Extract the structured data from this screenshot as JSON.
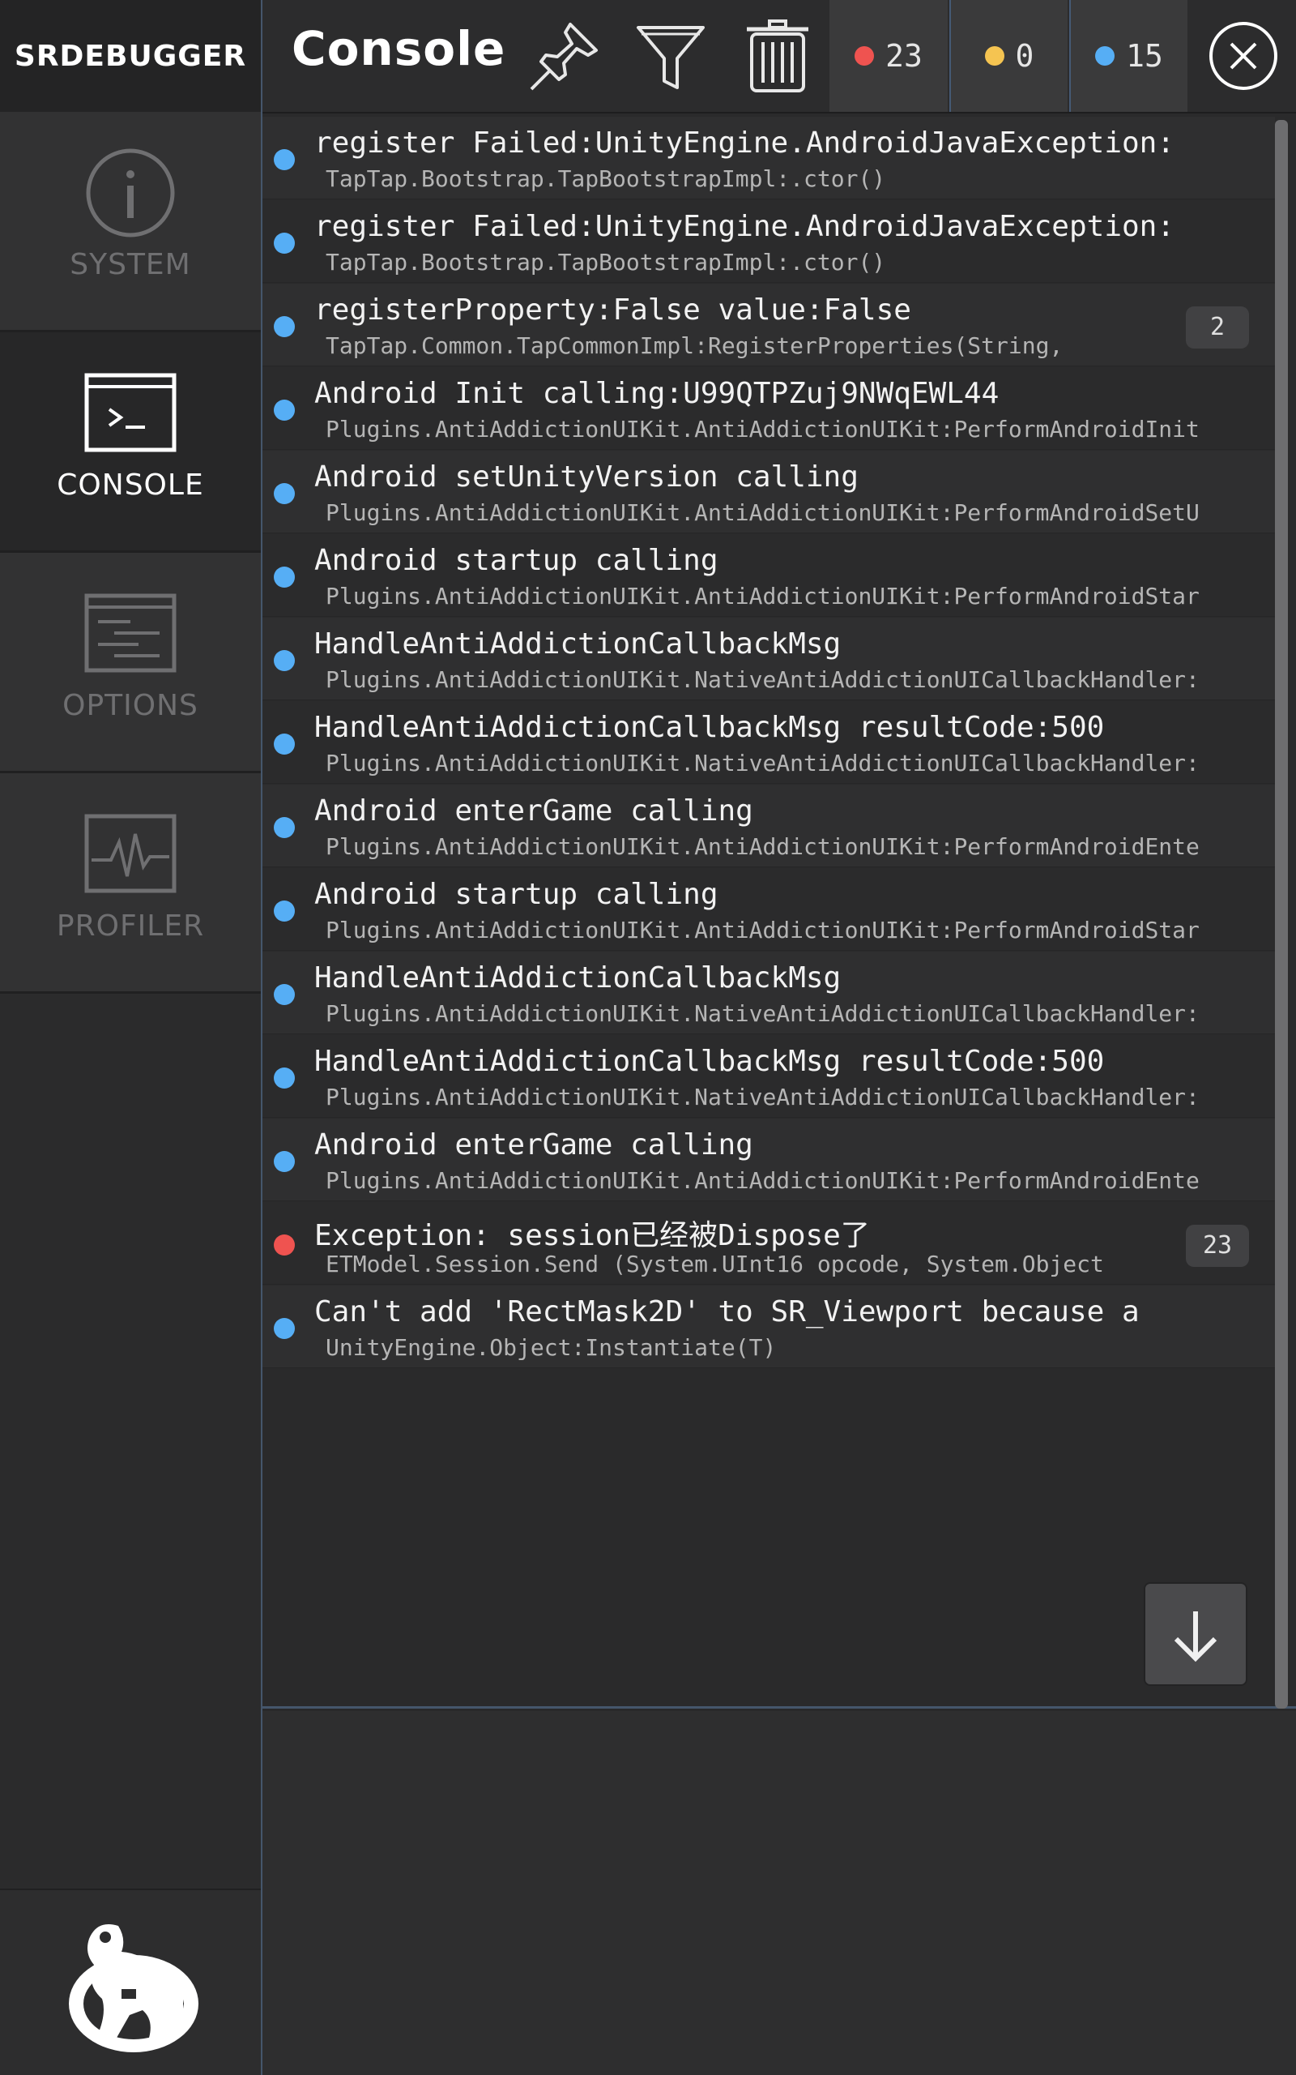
{
  "brand": {
    "prefix": "SR",
    "suffix": "DEBUGGER"
  },
  "sidebar": {
    "items": [
      {
        "label": "SYSTEM",
        "icon": "info-icon",
        "active": false
      },
      {
        "label": "CONSOLE",
        "icon": "terminal-icon",
        "active": true
      },
      {
        "label": "OPTIONS",
        "icon": "options-icon",
        "active": false
      },
      {
        "label": "PROFILER",
        "icon": "pulse-icon",
        "active": false
      }
    ],
    "footer_icon": "robot-logo-icon"
  },
  "header": {
    "title": "Console",
    "pin_icon": "pin-icon",
    "filter_icon": "filter-icon",
    "clear_icon": "trash-icon",
    "close_icon": "close-icon",
    "counters": {
      "error": {
        "count": "23",
        "color": "#ef5350"
      },
      "warning": {
        "count": "0",
        "color": "#f5c451"
      },
      "info": {
        "count": "15",
        "color": "#56aef5"
      }
    }
  },
  "colors": {
    "info": "#56aef5",
    "error": "#ef5350",
    "accent_border": "#45566b"
  },
  "logs": [
    {
      "level": "info",
      "message": "register Failed:UnityEngine.AndroidJavaException:",
      "trace": "TapTap.Bootstrap.TapBootstrapImpl:.ctor()",
      "count": ""
    },
    {
      "level": "info",
      "message": "register Failed:UnityEngine.AndroidJavaException:",
      "trace": "TapTap.Bootstrap.TapBootstrapImpl:.ctor()",
      "count": ""
    },
    {
      "level": "info",
      "message": "registerProperty:False value:False",
      "trace": "TapTap.Common.TapCommonImpl:RegisterProperties(String,",
      "count": "2"
    },
    {
      "level": "info",
      "message": "Android Init calling:U99QTPZuj9NWqEWL44",
      "trace": "Plugins.AntiAddictionUIKit.AntiAddictionUIKit:PerformAndroidInit",
      "count": ""
    },
    {
      "level": "info",
      "message": "Android setUnityVersion calling",
      "trace": "Plugins.AntiAddictionUIKit.AntiAddictionUIKit:PerformAndroidSetU",
      "count": ""
    },
    {
      "level": "info",
      "message": "Android startup calling",
      "trace": "Plugins.AntiAddictionUIKit.AntiAddictionUIKit:PerformAndroidStar",
      "count": ""
    },
    {
      "level": "info",
      "message": "HandleAntiAddictionCallbackMsg",
      "trace": "Plugins.AntiAddictionUIKit.NativeAntiAddictionUICallbackHandler:",
      "count": ""
    },
    {
      "level": "info",
      "message": "HandleAntiAddictionCallbackMsg resultCode:500",
      "trace": "Plugins.AntiAddictionUIKit.NativeAntiAddictionUICallbackHandler:",
      "count": ""
    },
    {
      "level": "info",
      "message": "Android enterGame calling",
      "trace": "Plugins.AntiAddictionUIKit.AntiAddictionUIKit:PerformAndroidEnte",
      "count": ""
    },
    {
      "level": "info",
      "message": "Android startup calling",
      "trace": "Plugins.AntiAddictionUIKit.AntiAddictionUIKit:PerformAndroidStar",
      "count": ""
    },
    {
      "level": "info",
      "message": "HandleAntiAddictionCallbackMsg",
      "trace": "Plugins.AntiAddictionUIKit.NativeAntiAddictionUICallbackHandler:",
      "count": ""
    },
    {
      "level": "info",
      "message": "HandleAntiAddictionCallbackMsg resultCode:500",
      "trace": "Plugins.AntiAddictionUIKit.NativeAntiAddictionUICallbackHandler:",
      "count": ""
    },
    {
      "level": "info",
      "message": "Android enterGame calling",
      "trace": "Plugins.AntiAddictionUIKit.AntiAddictionUIKit:PerformAndroidEnte",
      "count": ""
    },
    {
      "level": "error",
      "message": "Exception: session已经被Dispose了",
      "trace": "ETModel.Session.Send (System.UInt16 opcode, System.Object",
      "count": "23"
    },
    {
      "level": "info",
      "message": "Can't add 'RectMask2D' to SR_Viewport because a",
      "trace": "UnityEngine.Object:Instantiate(T)",
      "count": ""
    }
  ],
  "scroll_down_icon": "arrow-down-icon"
}
